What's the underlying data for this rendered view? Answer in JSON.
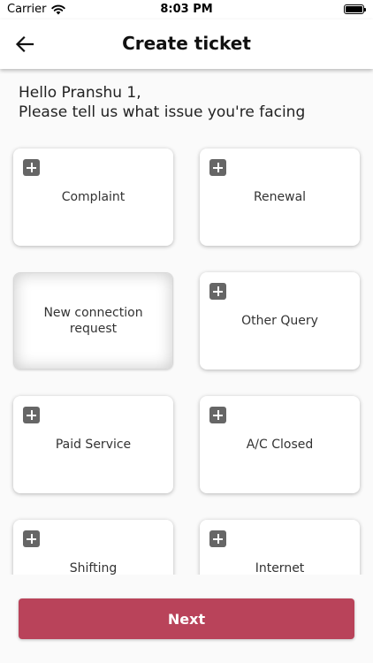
{
  "status_bar": {
    "carrier": "Carrier",
    "time": "8:03 PM"
  },
  "app_bar": {
    "title": "Create ticket"
  },
  "greeting": {
    "line1": "Hello Pranshu 1,",
    "line2": "Please tell us what issue you're facing"
  },
  "issues": [
    {
      "label": "Complaint",
      "selected": false
    },
    {
      "label": "Renewal",
      "selected": false
    },
    {
      "label": "New connection request",
      "selected": true
    },
    {
      "label": "Other Query",
      "selected": false
    },
    {
      "label": "Paid Service",
      "selected": false
    },
    {
      "label": "A/C Closed",
      "selected": false
    },
    {
      "label": "Shifting",
      "selected": false
    },
    {
      "label": "Internet",
      "selected": false
    }
  ],
  "footer": {
    "next_label": "Next"
  },
  "colors": {
    "accent": "#b9435a",
    "icon": "#666666",
    "background": "#fafafa"
  }
}
